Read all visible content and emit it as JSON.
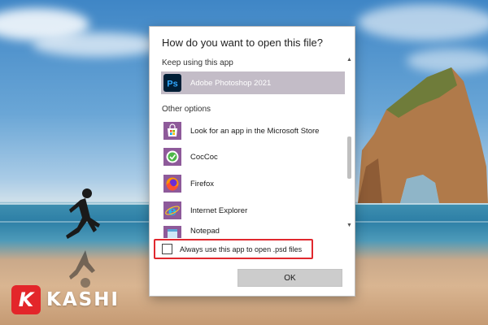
{
  "dialog": {
    "title": "How do you want to open this file?",
    "keep_label": "Keep using this app",
    "current_app": {
      "label": "Adobe Photoshop 2021",
      "icon": "photoshop-icon",
      "icon_text": "Ps"
    },
    "other_label": "Other options",
    "apps": [
      {
        "label": "Look for an app in the Microsoft Store",
        "icon": "microsoft-store-icon"
      },
      {
        "label": "CocCoc",
        "icon": "coccoc-icon"
      },
      {
        "label": "Firefox",
        "icon": "firefox-icon"
      },
      {
        "label": "Internet Explorer",
        "icon": "internet-explorer-icon",
        "icon_text": "e"
      },
      {
        "label": "Notepad",
        "icon": "notepad-icon"
      }
    ],
    "always_label": "Always use this app to open .psd files",
    "always_checked": false,
    "ok_label": "OK",
    "scroll_up_glyph": "▲",
    "scroll_down_glyph": "▼"
  },
  "watermark": {
    "badge": "K",
    "text": "KASHI"
  },
  "colors": {
    "selected_row": "#c3bcc7",
    "highlight_border": "#e0282e",
    "logo_red": "#e3262a",
    "ok_button": "#cccccc"
  }
}
